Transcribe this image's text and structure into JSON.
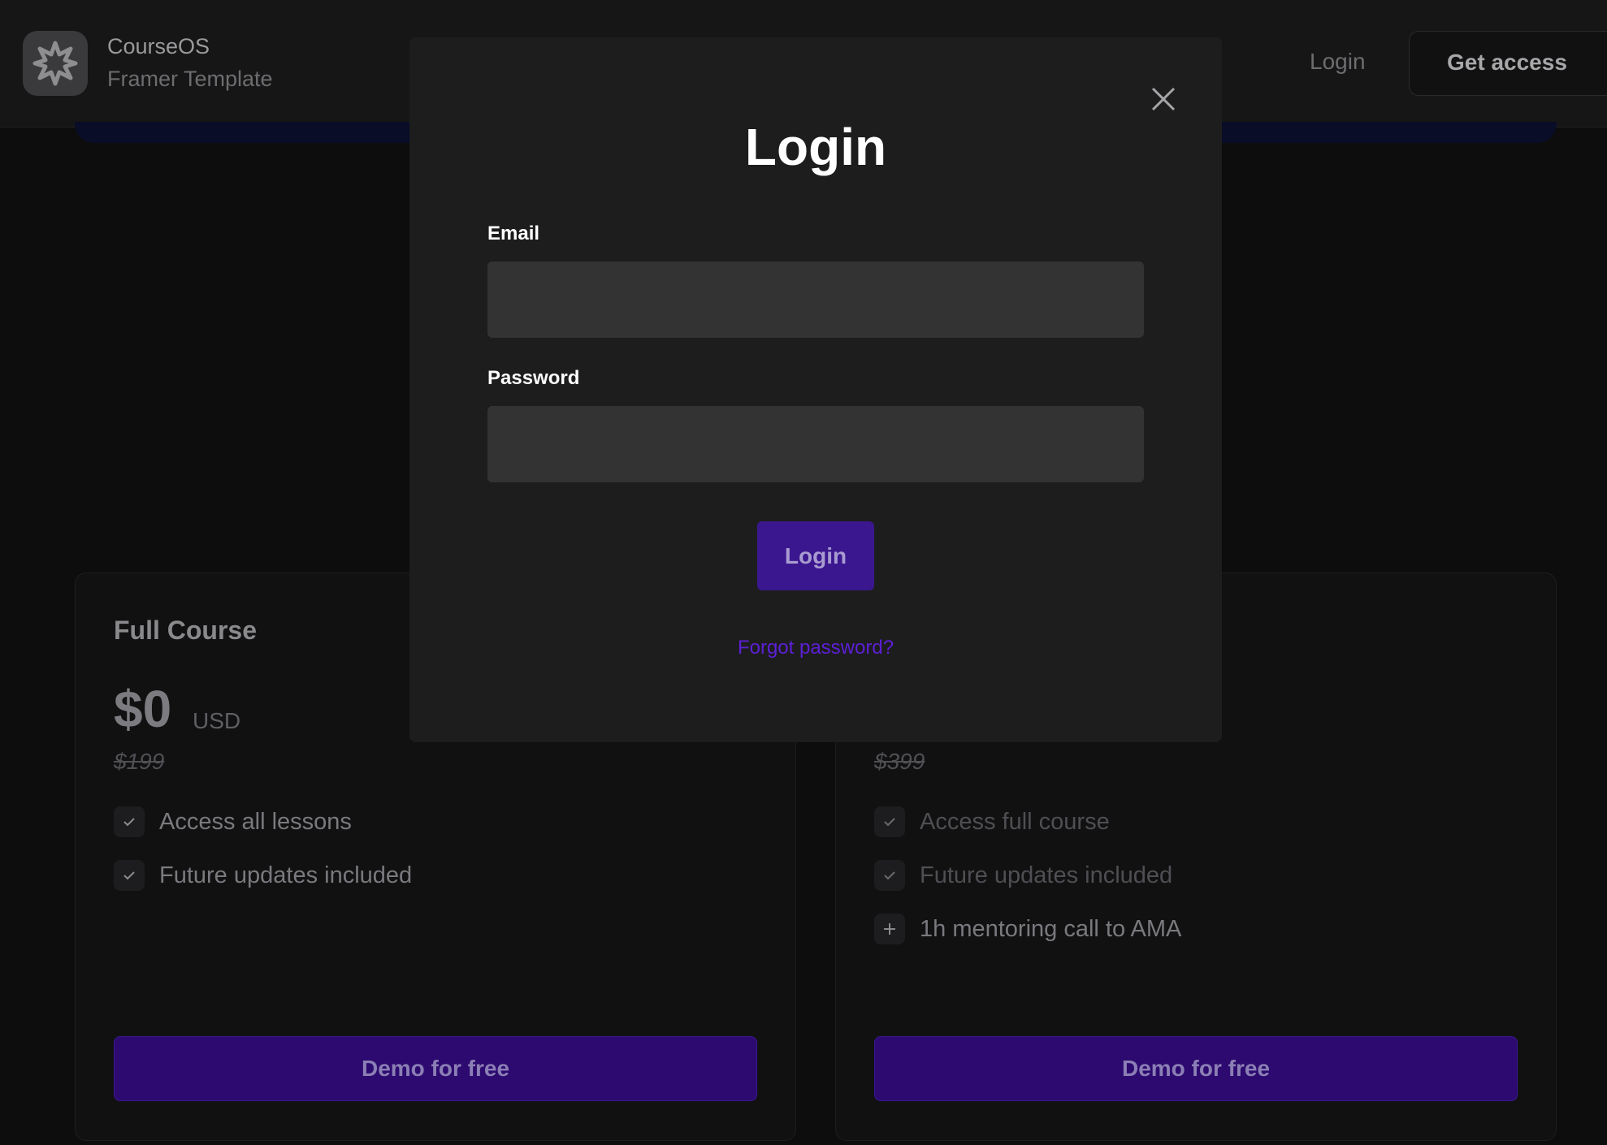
{
  "header": {
    "brand_name": "CourseOS",
    "brand_subtitle": "Framer Template",
    "nav_login": "Login",
    "nav_get_access": "Get access",
    "logo_icon": "star-burst-icon"
  },
  "pricing": {
    "cards": [
      {
        "title": "Full Course",
        "price": "$0",
        "currency": "USD",
        "old_price": "$199",
        "features": [
          "Access all lessons",
          "Future updates included"
        ],
        "cta": "Demo for free"
      },
      {
        "title": "",
        "price": "",
        "currency": "",
        "old_price": "$399",
        "features": [
          "Access full course",
          "Future updates included",
          "1h mentoring call to AMA"
        ],
        "feature_icons": [
          "check-icon",
          "check-icon",
          "plus-icon"
        ],
        "cta": "Demo for free"
      }
    ]
  },
  "modal": {
    "title": "Login",
    "email_label": "Email",
    "email_value": "",
    "password_label": "Password",
    "password_value": "",
    "submit_label": "Login",
    "forgot_label": "Forgot password?",
    "close_icon": "close-icon"
  },
  "colors": {
    "accent": "#3b178f",
    "link": "#5d1fd6",
    "modal_bg": "#1d1d1e",
    "input_bg": "#333334"
  }
}
